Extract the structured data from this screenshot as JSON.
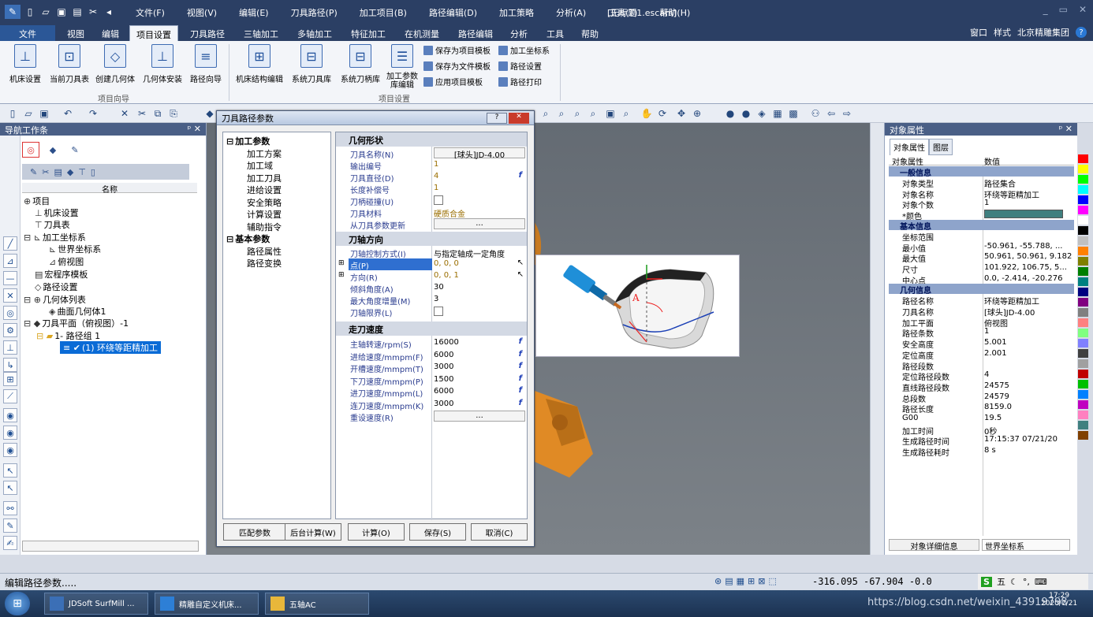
{
  "app": {
    "caption": "[无标题1.escam]",
    "title_menus": [
      "文件(F)",
      "视图(V)",
      "编辑(E)",
      "刀具路径(P)",
      "加工项目(B)",
      "路径编辑(D)",
      "加工策略",
      "分析(A)",
      "工具(T)",
      "帮助(H)"
    ],
    "window_controls": [
      "_",
      "▭",
      "✕"
    ]
  },
  "ribbon_tabs": [
    "文件",
    "视图",
    "编辑",
    "项目设置",
    "刀具路径",
    "三轴加工",
    "多轴加工",
    "特征加工",
    "在机测量",
    "路径编辑",
    "分析",
    "工具",
    "帮助"
  ],
  "active_tab": "项目设置",
  "right_controls": {
    "window": "窗口",
    "style": "样式",
    "company": "北京精雕集团",
    "help": "?"
  },
  "ribbon": {
    "group1_label": "项目向导",
    "group2_label": "项目设置",
    "buttons": [
      "机床设置",
      "当前刀具表",
      "创建几何体",
      "几何体安装",
      "路径向导",
      "机床结构编辑",
      "系统刀具库",
      "系统刀柄库",
      "加工参数库编辑"
    ],
    "small_buttons": [
      "保存为项目模板",
      "保存为文件模板",
      "应用项目模板",
      "加工坐标系",
      "路径设置",
      "路径打印"
    ]
  },
  "nav_panel": {
    "title": "导航工作条",
    "column_header": "名称",
    "tree": [
      {
        "label": "项目",
        "depth": 0
      },
      {
        "label": "机床设置",
        "depth": 1
      },
      {
        "label": "刀具表",
        "depth": 1
      },
      {
        "label": "加工坐标系",
        "depth": 1
      },
      {
        "label": "世界坐标系",
        "depth": 2
      },
      {
        "label": "俯视图",
        "depth": 2
      },
      {
        "label": "宏程序模板",
        "depth": 1
      },
      {
        "label": "路径设置",
        "depth": 1
      },
      {
        "label": "几何体列表",
        "depth": 1
      },
      {
        "label": "曲面几何体1",
        "depth": 2
      },
      {
        "label": "刀具平面（俯视图）-1",
        "depth": 1
      },
      {
        "label": "1- 路径组 1",
        "depth": 2
      },
      {
        "label": "(1) 环绕等距精加工",
        "depth": 3
      }
    ]
  },
  "dialog": {
    "title": "刀具路径参数",
    "tree": {
      "group1": "加工参数",
      "group1_items": [
        "加工方案",
        "加工域",
        "加工刀具",
        "进给设置",
        "安全策略",
        "计算设置",
        "辅助指令"
      ],
      "group2": "基本参数",
      "group2_items": [
        "路径属性",
        "路径变换"
      ]
    },
    "sections": {
      "geom": {
        "title": "几何形状",
        "rows": [
          {
            "name": "刀具名称(N)",
            "value": "[球头]JD-4.00"
          },
          {
            "name": "输出编号",
            "value": "1"
          },
          {
            "name": "刀具直径(D)",
            "value": "4"
          },
          {
            "name": "长度补偿号",
            "value": "1"
          },
          {
            "name": "刀柄碰撞(U)",
            "value": ""
          },
          {
            "name": "刀具材料",
            "value": "硬质合金"
          },
          {
            "name": "从刀具参数更新",
            "value": "..."
          }
        ]
      },
      "axis": {
        "title": "刀轴方向",
        "rows": [
          {
            "name": "刀轴控制方式(I)",
            "value": "与指定轴成一定角度"
          },
          {
            "name": "点(P)",
            "value": "0, 0, 0"
          },
          {
            "name": "方向(R)",
            "value": "0, 0, 1"
          },
          {
            "name": "倾斜角度(A)",
            "value": "30"
          },
          {
            "name": "最大角度增量(M)",
            "value": "3"
          },
          {
            "name": "刀轴限界(L)",
            "value": ""
          }
        ]
      },
      "speed": {
        "title": "走刀速度",
        "rows": [
          {
            "name": "主轴转速/rpm(S)",
            "value": "16000"
          },
          {
            "name": "进给速度/mmpm(F)",
            "value": "6000"
          },
          {
            "name": "开槽速度/mmpm(T)",
            "value": "3000"
          },
          {
            "name": "下刀速度/mmpm(P)",
            "value": "1500"
          },
          {
            "name": "进刀速度/mmpm(L)",
            "value": "6000"
          },
          {
            "name": "连刀速度/mmpm(K)",
            "value": "3000"
          },
          {
            "name": "重设速度(R)",
            "value": "..."
          }
        ]
      }
    },
    "buttons": {
      "match": "匹配参数",
      "background": "后台计算(W)",
      "calc": "计算(O)",
      "save": "保存(S)",
      "cancel": "取消(C)"
    },
    "preview_label": "A"
  },
  "obj_panel": {
    "title": "对象属性",
    "tabs": [
      "对象属性",
      "图层"
    ],
    "col_name": "对象属性",
    "col_value": "数值",
    "sections": [
      {
        "title": "一般信息",
        "rows": [
          {
            "name": "对象类型",
            "value": "路径集合"
          },
          {
            "name": "对象名称",
            "value": "环绕等距精加工"
          },
          {
            "name": "对象个数",
            "value": "1"
          },
          {
            "name": "*颜色",
            "value": ""
          }
        ]
      },
      {
        "title": "基本信息",
        "rows": [
          {
            "name": "坐标范围",
            "value": ""
          },
          {
            "name": "最小值",
            "value": "-50.961, -55.788, ..."
          },
          {
            "name": "最大值",
            "value": "50.961, 50.961, 9.182"
          },
          {
            "name": "尺寸",
            "value": "101.922, 106.75, 5..."
          },
          {
            "name": "中心点",
            "value": "0.0, -2.414, -20.276"
          }
        ]
      },
      {
        "title": "几何信息",
        "rows": [
          {
            "name": "路径名称",
            "value": "环绕等距精加工"
          },
          {
            "name": "刀具名称",
            "value": "[球头]JD-4.00"
          },
          {
            "name": "加工平面",
            "value": "俯视图"
          },
          {
            "name": "路径条数",
            "value": "1"
          },
          {
            "name": "安全高度",
            "value": "5.001"
          },
          {
            "name": "定位高度",
            "value": "2.001"
          },
          {
            "name": "路径段数",
            "value": ""
          },
          {
            "name": "定位路径段数",
            "value": "4"
          },
          {
            "name": "直线路径段数",
            "value": "24575"
          },
          {
            "name": "总段数",
            "value": "24579"
          },
          {
            "name": "路径长度",
            "value": "8159.0"
          },
          {
            "name": "G00",
            "value": "19.5"
          },
          {
            "name": "加工时间",
            "value": "0秒"
          },
          {
            "name": "生成路径时间",
            "value": "17:15:37 07/21/20"
          },
          {
            "name": "生成路径耗时",
            "value": "8 s"
          }
        ]
      }
    ],
    "footer_left": "对象详细信息",
    "footer_right": "世界坐标系",
    "palette": [
      "#ff0000",
      "#ffff00",
      "#00ff00",
      "#00ffff",
      "#0000ff",
      "#ff00ff",
      "#ffffff",
      "#000000",
      "#c0c0c0",
      "#ff8000",
      "#808000",
      "#008000",
      "#008080",
      "#000080",
      "#800080",
      "#808080",
      "#ff8080",
      "#80ff80",
      "#8080ff",
      "#404040",
      "#a0a0a0",
      "#c00000",
      "#00c000",
      "#0080ff",
      "#c000c0",
      "#ff80c0",
      "#408080",
      "#804000"
    ]
  },
  "status": {
    "message": "编辑路径参数.....",
    "coords": "-316.095  -67.904  -0.0"
  },
  "taskbar": {
    "items": [
      "JDSoft SurfMill ...",
      "精雕自定义机床...",
      "五轴AC"
    ],
    "ime": "五",
    "watermark": "https://blog.csdn.net/weixin_43919798",
    "clock_time": "17:29",
    "clock_date": "2020/7/21"
  }
}
